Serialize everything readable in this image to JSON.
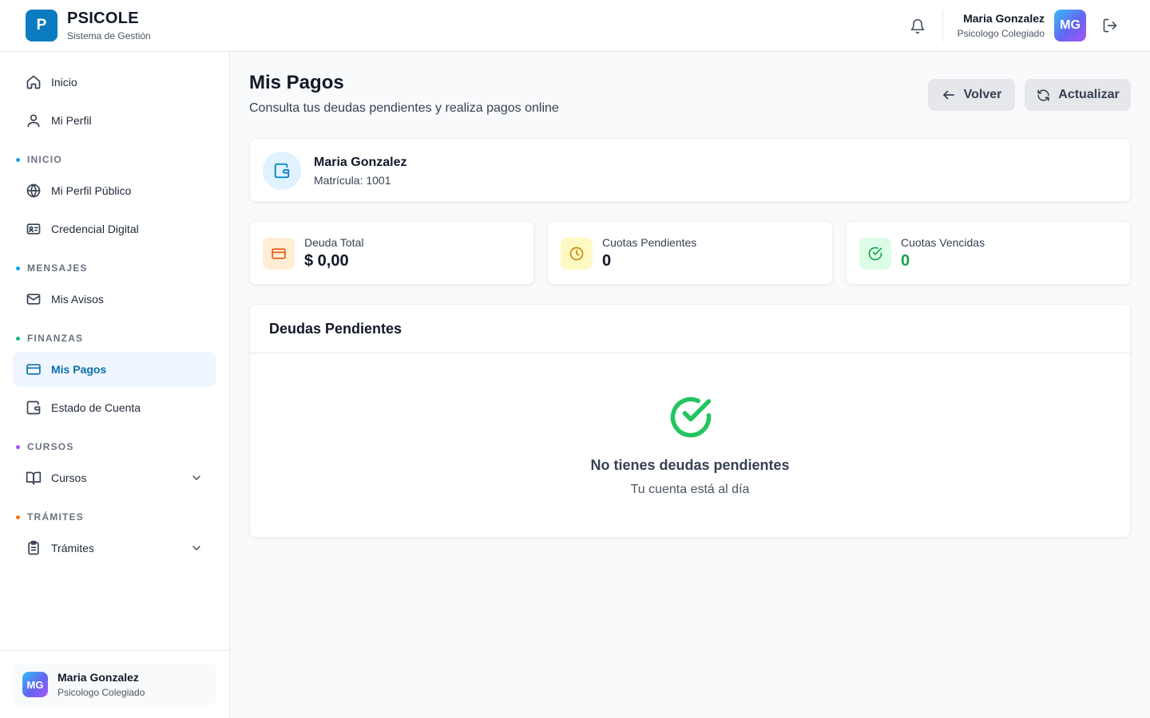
{
  "brand": {
    "logo_letter": "P",
    "name": "PSICOLE",
    "subtitle": "Sistema de Gestión"
  },
  "header": {
    "user_name": "Maria Gonzalez",
    "user_role": "Psicologo Colegiado",
    "avatar_initials": "MG",
    "icons": [
      "bell-icon",
      "logout-icon"
    ]
  },
  "sidebar": {
    "items": [
      {
        "label": "Inicio",
        "icon": "home-icon"
      },
      {
        "label": "Mi Perfil",
        "icon": "user-icon"
      }
    ],
    "sections": [
      {
        "label": "INICIO",
        "dot_color": "#0ea5e9",
        "items": [
          {
            "label": "Mi Perfil Público",
            "icon": "globe-icon"
          },
          {
            "label": "Credencial Digital",
            "icon": "id-card-icon"
          }
        ]
      },
      {
        "label": "MENSAJES",
        "dot_color": "#0ea5e9",
        "items": [
          {
            "label": "Mis Avisos",
            "icon": "mail-icon"
          }
        ]
      },
      {
        "label": "FINANZAS",
        "dot_color": "#10b981",
        "items": [
          {
            "label": "Mis Pagos",
            "icon": "credit-card-icon",
            "active": true
          },
          {
            "label": "Estado de Cuenta",
            "icon": "wallet-icon"
          }
        ]
      },
      {
        "label": "CURSOS",
        "dot_color": "#a855f7",
        "items": [
          {
            "label": "Cursos",
            "icon": "book-icon",
            "expandable": true
          }
        ]
      },
      {
        "label": "TRÁMITES",
        "dot_color": "#f97316",
        "items": [
          {
            "label": "Trámites",
            "icon": "clipboard-icon",
            "expandable": true
          }
        ]
      }
    ],
    "footer_user": {
      "name": "Maria Gonzalez",
      "role": "Psicologo Colegiado",
      "initials": "MG"
    }
  },
  "page": {
    "title": "Mis Pagos",
    "subtitle": "Consulta tus deudas pendientes y realiza pagos online",
    "back_label": "Volver",
    "refresh_label": "Actualizar"
  },
  "profile": {
    "name": "Maria Gonzalez",
    "matricula": "Matrícula: 1001"
  },
  "stats": [
    {
      "label": "Deuda Total",
      "value": "$ 0,00",
      "color": "#ea580c",
      "bg": "#ffedd5"
    },
    {
      "label": "Cuotas Pendientes",
      "value": "0",
      "color": "#ca8a04",
      "bg": "#fef9c3"
    },
    {
      "label": "Cuotas Vencidas",
      "value": "0",
      "color": "#16a34a",
      "bg": "#dcfce7"
    }
  ],
  "debts": {
    "title": "Deudas Pendientes",
    "empty_title": "No tienes deudas pendientes",
    "empty_subtitle": "Tu cuenta está al día"
  },
  "colors": {
    "brand": "#0c7cc0",
    "active_bg": "#eff6ff",
    "active_text": "#0b6fae",
    "success": "#22c55e"
  }
}
